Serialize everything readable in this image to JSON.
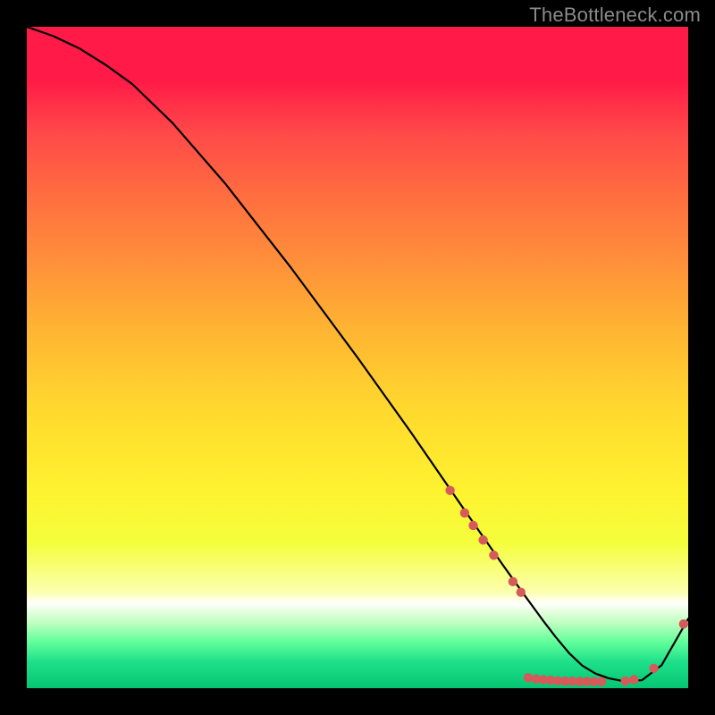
{
  "watermark": "TheBottleneck.com",
  "colors": {
    "background": "#000000",
    "curve": "#000000",
    "dots": "#d65a5a"
  },
  "chart_data": {
    "type": "line",
    "title": "",
    "xlabel": "",
    "ylabel": "",
    "xlim": [
      0,
      100
    ],
    "ylim": [
      0,
      100
    ],
    "grid": false,
    "legend": false,
    "series": [
      {
        "name": "bottleneck-curve",
        "x": [
          0,
          4,
          8,
          12,
          16,
          22,
          30,
          40,
          50,
          58,
          64,
          68,
          72,
          75,
          78,
          80,
          82,
          84,
          86,
          88,
          90,
          93,
          96,
          100
        ],
        "y": [
          100,
          98.6,
          96.7,
          94.2,
          91.3,
          85.5,
          76.3,
          63.5,
          50.0,
          38.8,
          30.1,
          24.3,
          18.6,
          14.4,
          10.3,
          7.7,
          5.3,
          3.4,
          2.2,
          1.5,
          1.1,
          1.2,
          3.5,
          10.5
        ]
      }
    ],
    "scatter_points": {
      "name": "highlighted-points",
      "x": [
        64,
        66.2,
        67.5,
        69,
        70.6,
        73.5,
        74.7,
        75.8,
        77,
        78.1,
        79.2,
        80.3,
        81.4,
        82.5,
        83.6,
        84.7,
        85.8,
        86.9,
        90.5,
        91.8,
        94.8,
        99.3
      ],
      "y": [
        29.9,
        26.5,
        24.6,
        22.4,
        20.1,
        16.1,
        14.5,
        1.6,
        1.4,
        1.3,
        1.2,
        1.12,
        1.08,
        1.05,
        1.02,
        1.01,
        1.0,
        1.0,
        1.08,
        1.3,
        3.0,
        9.7
      ]
    },
    "background_gradient": {
      "top": "#ff1a47",
      "mid": "#ffe031",
      "bottom": "#05c572"
    }
  }
}
